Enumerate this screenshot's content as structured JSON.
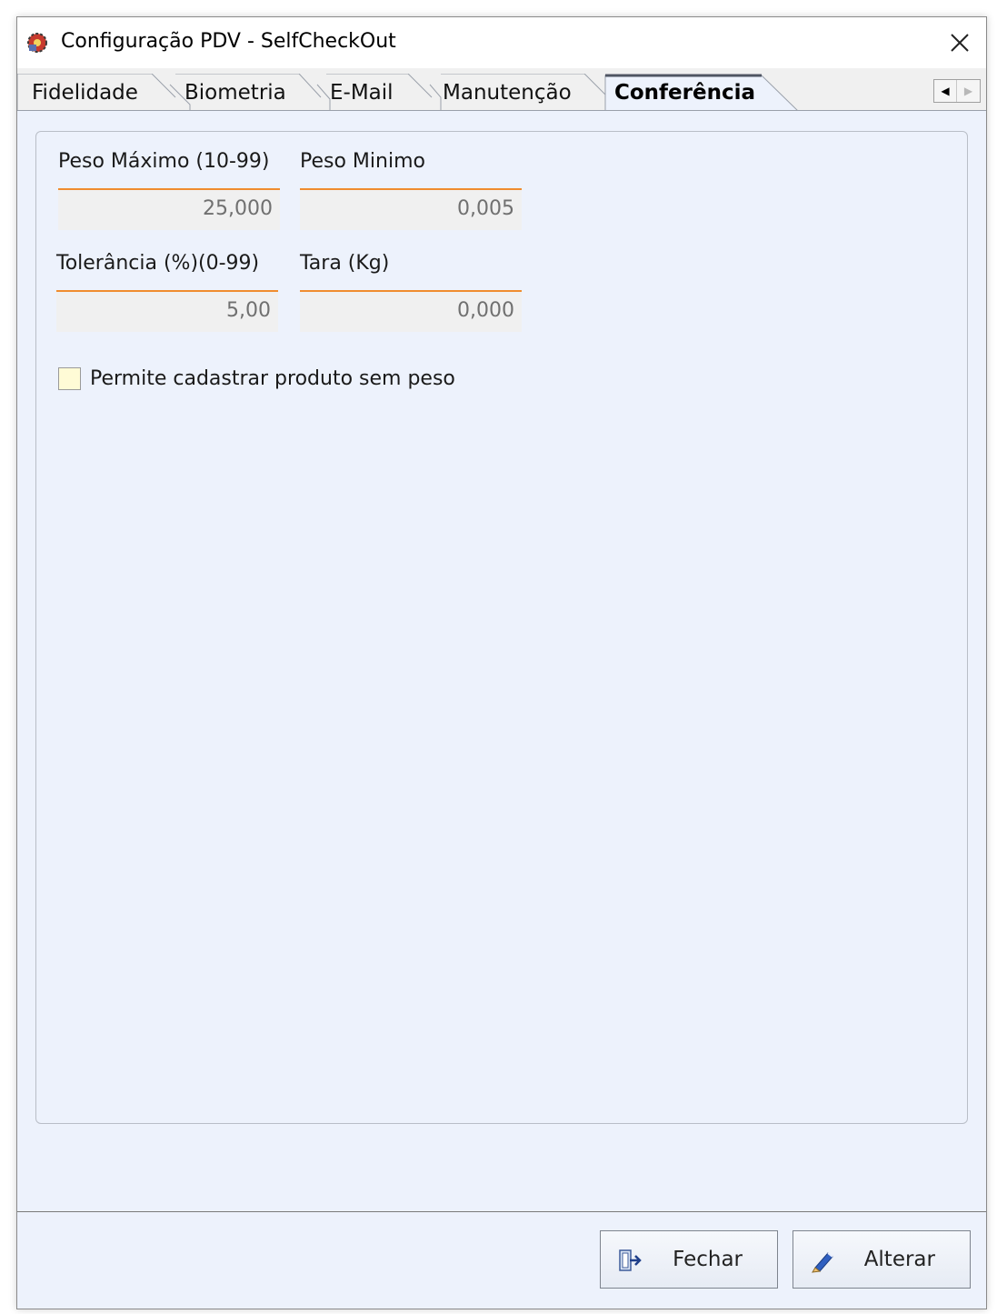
{
  "window": {
    "title": "Configuração PDV - SelfCheckOut"
  },
  "tabs": [
    {
      "label": "Fidelidade",
      "active": false
    },
    {
      "label": "Biometria",
      "active": false
    },
    {
      "label": "E-Mail",
      "active": false
    },
    {
      "label": "Manutenção",
      "active": false
    },
    {
      "label": "Conferência",
      "active": true
    }
  ],
  "form": {
    "peso_maximo": {
      "label": "Peso Máximo (10-99)",
      "value": "25,000"
    },
    "peso_minimo": {
      "label": "Peso Minimo",
      "value": "0,005"
    },
    "tolerancia": {
      "label": "Tolerância (%)(0-99)",
      "value": "5,00"
    },
    "tara": {
      "label": "Tara (Kg)",
      "value": "0,000"
    },
    "permite_sem_peso": {
      "label": "Permite cadastrar produto sem peso",
      "checked": false
    }
  },
  "buttons": {
    "fechar": "Fechar",
    "alterar": "Alterar"
  },
  "colors": {
    "accent_underline": "#f08c2e",
    "page_background": "#edf2fc",
    "checkbox_fill": "#fffbd6"
  },
  "icons": {
    "app": "gear-app-icon",
    "close": "close-icon",
    "scroll_left": "triangle-left-icon",
    "scroll_right": "triangle-right-icon",
    "fechar": "exit-door-icon",
    "alterar": "pencil-icon"
  }
}
